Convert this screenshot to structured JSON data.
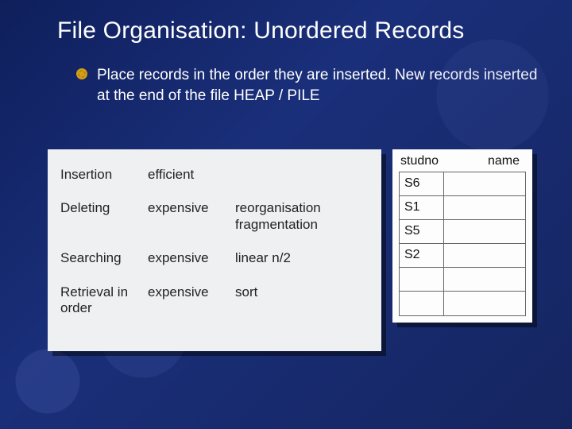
{
  "title": "File Organisation: Unordered Records",
  "bullet": "Place records in the order they are inserted. New records inserted at the end of the file  HEAP / PILE",
  "ops": [
    {
      "name": "Insertion",
      "cost": "efficient",
      "note": ""
    },
    {
      "name": "Deleting",
      "cost": "expensive",
      "note": "reorganisation fragmentation"
    },
    {
      "name": "Searching",
      "cost": "expensive",
      "note": "linear n/2"
    },
    {
      "name": "Retrieval in order",
      "cost": "expensive",
      "note": "sort"
    }
  ],
  "records": {
    "headers": {
      "col1": "studno",
      "col2": "name"
    },
    "rows": [
      "S6",
      "S1",
      "S5",
      "S2",
      "",
      ""
    ]
  }
}
